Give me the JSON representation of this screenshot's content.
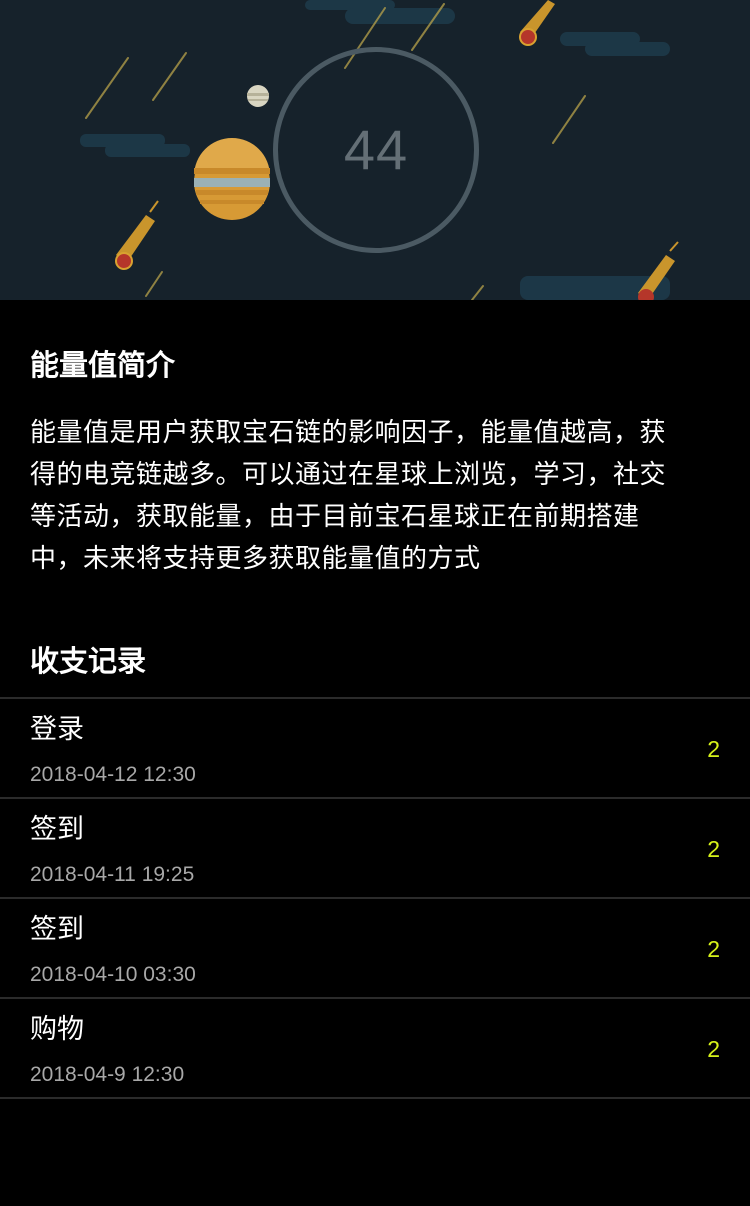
{
  "hero": {
    "energy_value": "44"
  },
  "intro": {
    "title": "能量值简介",
    "lines": [
      "能量值是用户获取宝石链的影响因子，能量值越高，获",
      "得的电竞链越多。可以通过在星球上浏览，学习，社交",
      "等活动，获取能量，由于目前宝石星球正在前期搭建",
      "中，未来将支持更多获取能量值的方式"
    ]
  },
  "records": {
    "title": "收支记录",
    "items": [
      {
        "name": "登录",
        "time": "2018-04-12 12:30",
        "amount": "2"
      },
      {
        "name": "签到",
        "time": "2018-04-11 19:25",
        "amount": "2"
      },
      {
        "name": "签到",
        "time": "2018-04-10 03:30",
        "amount": "2"
      },
      {
        "name": "购物",
        "time": "2018-04-9 12:30",
        "amount": "2"
      }
    ]
  },
  "colors": {
    "page_background": "#000000",
    "hero_background": "#16222b",
    "ring": "#4b5a63",
    "energy_value": "#646f76",
    "amount": "#d6f21a",
    "time_text": "#a8a8a8",
    "divider": "#2b2b2b"
  }
}
